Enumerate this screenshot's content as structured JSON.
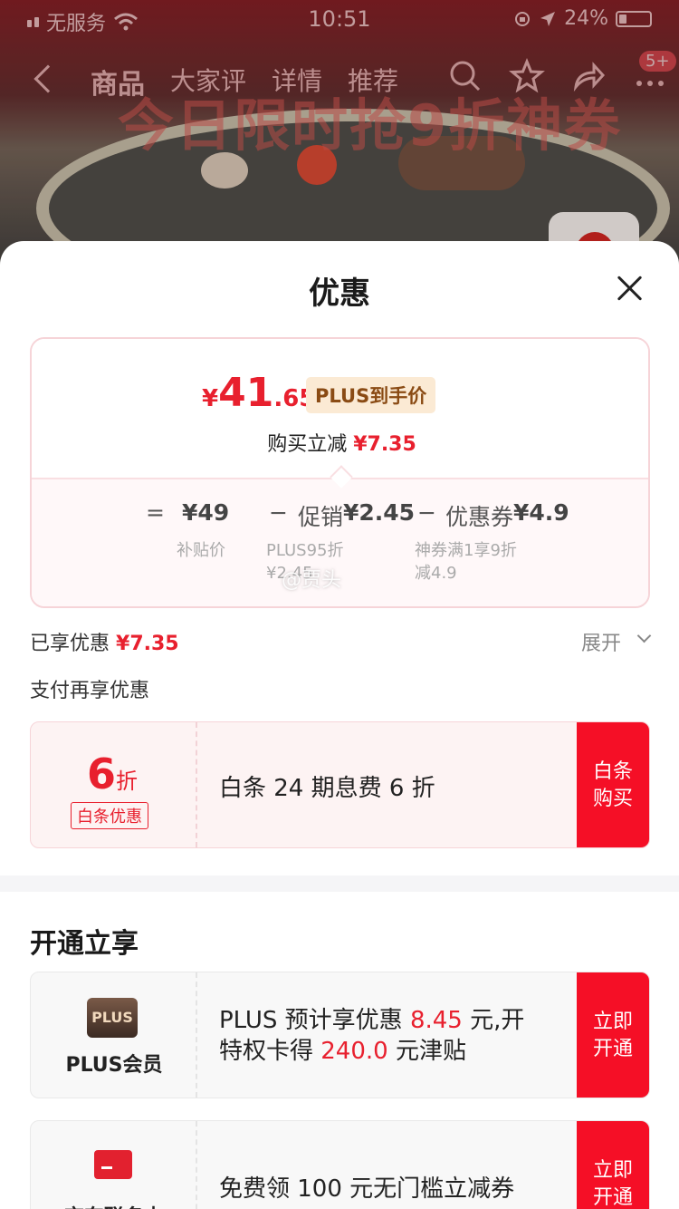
{
  "status_bar": {
    "carrier": "无服务",
    "time": "10:51",
    "battery": "24%"
  },
  "nav": {
    "tabs": [
      "商品",
      "大家评",
      "详情",
      "推荐"
    ],
    "active_tab": "商品",
    "badge": "5+",
    "icons": [
      "search-icon",
      "star-icon",
      "share-icon",
      "more-icon"
    ]
  },
  "background": {
    "banner_text": "今日限时抢9折神券"
  },
  "sheet": {
    "title": "优惠",
    "price": {
      "currency": "¥",
      "integer": "41",
      "decimal": ".65",
      "tag": "PLUS到手价"
    },
    "reduce": {
      "label": "购买立减",
      "value": "¥7.35"
    },
    "calc": {
      "eq": "=",
      "base": "¥49",
      "base_sub": "补贴价",
      "minus1": "−",
      "promo_label": "促销",
      "promo_value": "¥2.45",
      "promo_sub1": "PLUS95折",
      "promo_sub2": "¥2.45",
      "minus2": "−",
      "coupon_label": "优惠券",
      "coupon_value": "¥4.9",
      "coupon_sub1": "神券满1享9折",
      "coupon_sub2": "减4.9",
      "watermark": "@贾头"
    },
    "enjoyed": {
      "label": "已享优惠",
      "value": "¥7.35",
      "expand": "展开"
    },
    "pay_title": "支付再享优惠",
    "baitiao": {
      "discount_num": "6",
      "discount_unit": "折",
      "tag": "白条优惠",
      "desc": "白条 24 期息费 6 折",
      "cta_line1": "白条",
      "cta_line2": "购买"
    },
    "open_title": "开通立享",
    "plus_card": {
      "logo": "PLUS",
      "name": "PLUS会员",
      "desc_1": "PLUS 预计享优惠 ",
      "desc_amount1": "8.45",
      "desc_2": " 元,开",
      "desc_3": "特权卡得 ",
      "desc_amount2": "240.0",
      "desc_4": " 元津贴",
      "cta_line1": "立即",
      "cta_line2": "开通"
    },
    "jd_card": {
      "name": "京东联名卡",
      "desc": "免费领 100 元无门槛立减券",
      "cta_line1": "立即",
      "cta_line2": "开通"
    }
  },
  "colors": {
    "accent_red": "#e8202e",
    "cta_red": "#f50f26",
    "plus_tag_bg": "#fbead4"
  }
}
